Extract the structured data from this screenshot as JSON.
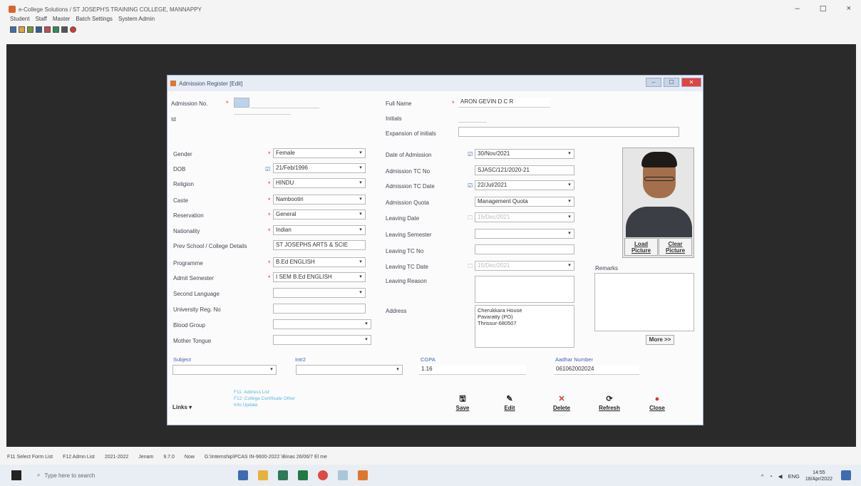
{
  "window": {
    "title": "e-College Solutions / ST JOSEPH'S TRAINING COLLEGE, MANNAPPY"
  },
  "menu": [
    "Student",
    "Staff",
    "Master",
    "Batch Settings",
    "System Admin"
  ],
  "dialog": {
    "title": "Admission Register [Edit]"
  },
  "form": {
    "admission_no_label": "Admission No.",
    "admission_no": "",
    "id_label": "Id",
    "full_name_label": "Full Name",
    "full_name": "ARON GEVIN D C R",
    "initials_label": "Initials",
    "expansion_label": "Expansion of initials",
    "gender_label": "Gender",
    "gender": "Female",
    "dob_label": "DOB",
    "dob": "21/Feb/1996",
    "religion_label": "Religion",
    "religion": "HINDU",
    "caste_label": "Caste",
    "caste": "Nambootiri",
    "reservation_label": "Reservation",
    "reservation": "General",
    "nationality_label": "Nationality",
    "nationality": "Indian",
    "prev_school_label": "Prev School / College Details",
    "prev_school": "ST JOSEPHS ARTS & SCIE",
    "programme_label": "Programme",
    "programme": "B.Ed ENGLISH",
    "admit_semester_label": "Admit Semester",
    "admit_semester": "I SEM B.Ed ENGLISH",
    "second_language_label": "Second Language",
    "univ_reg_label": "University Reg. No",
    "blood_group_label": "Blood Group",
    "mother_tongue_label": "Mother Tongue",
    "date_admission_label": "Date of Admission",
    "date_admission": "30/Nov/2021",
    "adm_tc_no_label": "Admission TC No",
    "adm_tc_no": "SJASC/121/2020-21",
    "adm_tc_date_label": "Admission TC Date",
    "adm_tc_date": "22/Jul/2021",
    "adm_quota_label": "Admission Quota",
    "adm_quota": "Management Quota",
    "leaving_date_label": "Leaving Date",
    "leaving_date": "15/Dec/2021",
    "leaving_sem_label": "Leaving Semester",
    "leaving_tc_no_label": "Leaving TC No",
    "leaving_tc_date_label": "Leaving TC Date",
    "leaving_tc_date": "15/Dec/2021",
    "leaving_reason_label": "Leaving Reason",
    "address_label": "Address",
    "address": "Cherukkara House\nPavaratty (PO)\nThrissur-680507",
    "remarks_label": "Remarks",
    "subject_label": "Subject",
    "intr2_label": "Intr2",
    "cgpa_label": "CGPA",
    "cgpa": "1.16",
    "aadhar_label": "Aadhar Number",
    "aadhar": "061062002024"
  },
  "photo": {
    "load": "Load Picture",
    "clear": "Clear Picture"
  },
  "more_label": "More >>",
  "links": {
    "label": "Links",
    "items": [
      "F11: Address List",
      "F12: College Certificate Other",
      "Info Update"
    ]
  },
  "actions": [
    {
      "label": "Save",
      "icon": "save-icon",
      "glyph": "🖫"
    },
    {
      "label": "Edit",
      "icon": "edit-icon",
      "glyph": "✎"
    },
    {
      "label": "Delete",
      "icon": "delete-icon",
      "glyph": "✕"
    },
    {
      "label": "Refresh",
      "icon": "refresh-icon",
      "glyph": "⟳"
    },
    {
      "label": "Close",
      "icon": "close-icon",
      "glyph": "●"
    }
  ],
  "status": [
    "F11 Select Form List",
    "F12 Admn List",
    "2021-2022",
    "Jenam",
    "9.7.0",
    "Now",
    "G:\\Intemship\\PCAS IN-9600-2022 \\Binas 26/06/7 El me"
  ],
  "taskbar": {
    "search": "Type here to search",
    "lang": "ENG",
    "time": "14:55",
    "date": "18/Apr/2022"
  }
}
